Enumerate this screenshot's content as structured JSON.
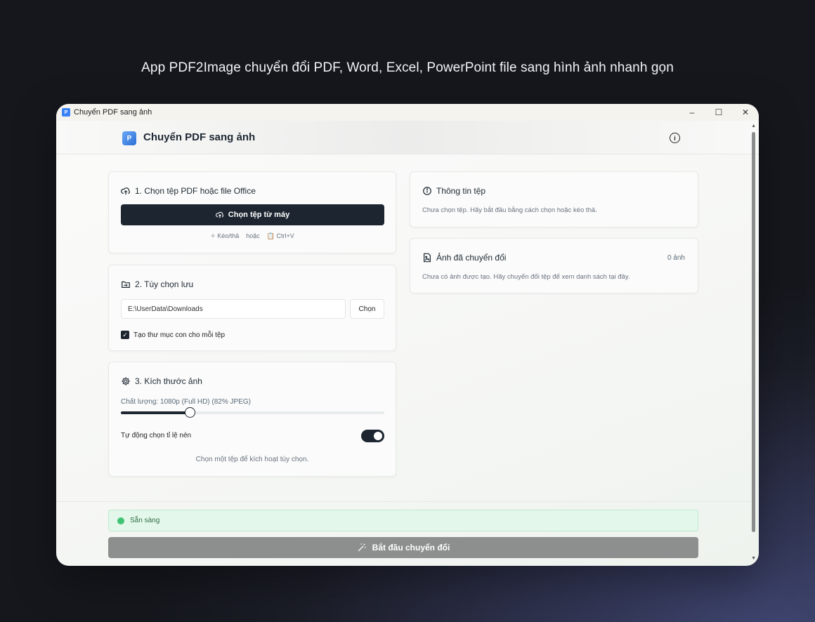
{
  "hero": {
    "title": "App PDF2Image chuyển đổi PDF, Word, Excel, PowerPoint file sang hình ảnh nhanh gọn"
  },
  "window": {
    "title": "Chuyển PDF sang ảnh",
    "controls": {
      "minimize": "–",
      "maximize": "☐",
      "close": "✕"
    }
  },
  "header": {
    "title": "Chuyển PDF sang ảnh",
    "logo_icon": "pdf-image-logo",
    "info_icon": "info-icon"
  },
  "select_file": {
    "title": "1. Chọn tệp PDF hoặc file Office",
    "button_label": "Chọn tệp từ máy",
    "hint_drag": "Kéo/thả",
    "hint_or": "hoặc",
    "hint_paste": "Ctrl+V"
  },
  "save_options": {
    "title": "2. Tùy chọn lưu",
    "path_value": "E:\\UserData\\Downloads",
    "choose_label": "Chọn",
    "subfolder_label": "Tạo thư mục con cho mỗi tệp",
    "subfolder_checked": true
  },
  "image_size": {
    "title": "3. Kích thước ảnh",
    "quality_label": "Chất lượng: 1080p (Full HD) (82% JPEG)",
    "slider_fraction": 0.26,
    "auto_label": "Tự động chọn tỉ lệ nén",
    "auto_enabled": true,
    "hint": "Chọn một tệp để kích hoạt tùy chọn."
  },
  "file_info": {
    "title": "Thông tin tệp",
    "text": "Chưa chọn tệp. Hãy bắt đầu bằng cách chọn hoặc kéo thả."
  },
  "converted": {
    "title": "Ảnh đã chuyển đổi",
    "count": "0 ảnh",
    "text": "Chưa có ảnh được tạo. Hãy chuyển đổi tệp để xem danh sách tại đây."
  },
  "status": {
    "text": "Sẵn sàng",
    "color": "#41c374"
  },
  "start": {
    "label": "Bắt đầu chuyển đổi"
  },
  "colors": {
    "primary": "#1c2530",
    "status_bg": "#e3f8ea",
    "disabled_button": "#8c8f8e"
  }
}
